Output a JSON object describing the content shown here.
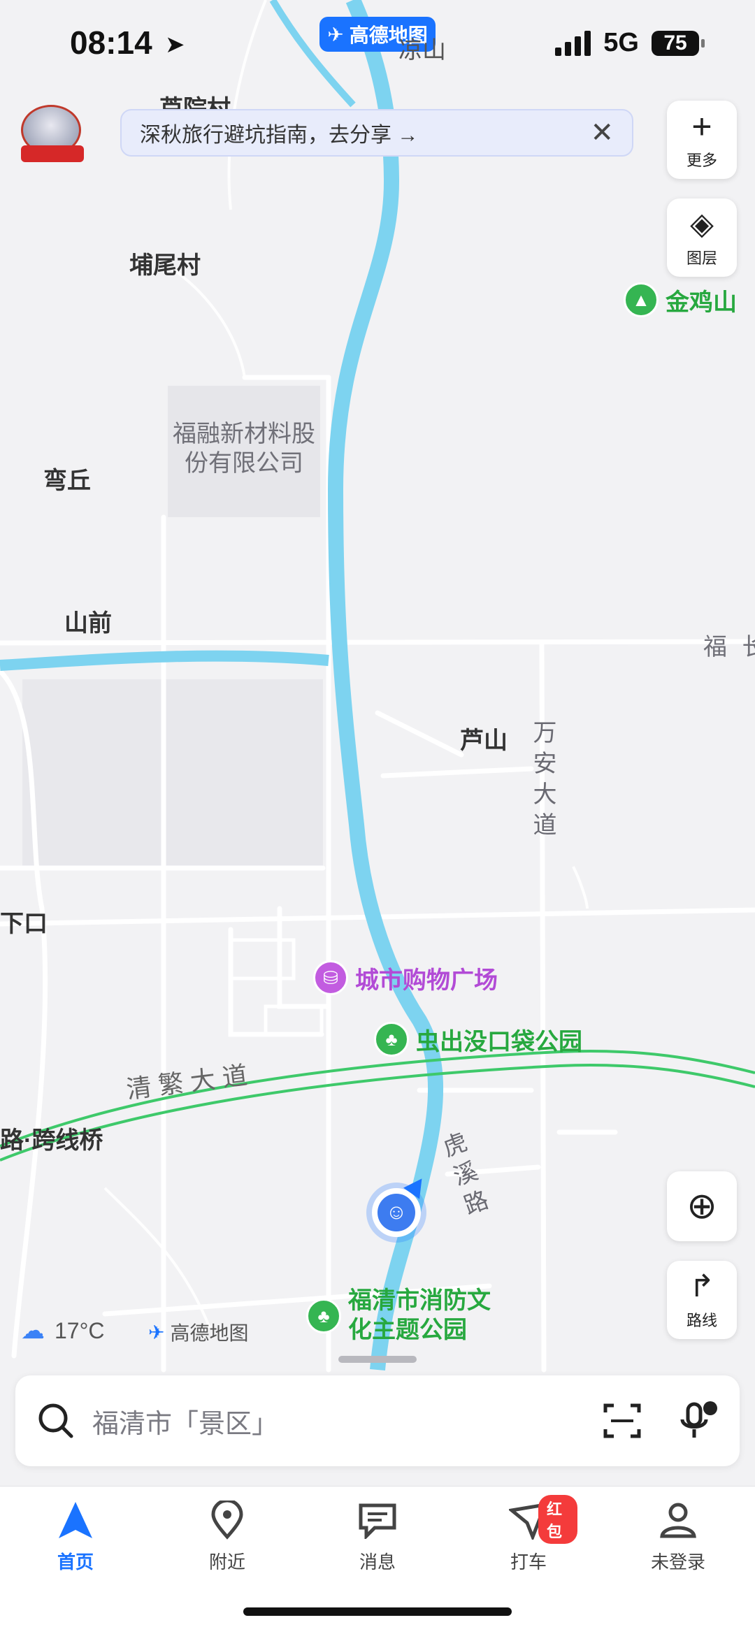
{
  "status": {
    "time": "08:14",
    "network": "5G",
    "battery": "75"
  },
  "app_pill": "高德地图",
  "banner": {
    "text": "深秋旅行避坑指南，去分享 →"
  },
  "side_buttons": {
    "more": "更多",
    "layers": "图层",
    "route": "路线"
  },
  "map": {
    "labels": {
      "top_partial": "芦院村",
      "top_mountain": "凉山",
      "village1": "埔尾村",
      "company": "福融新材料股份有限公司",
      "wanqiu": "弯丘",
      "shanqian": "山前",
      "lushan": "芦山",
      "road_wanan": "万安大道",
      "xiakou": "下口",
      "road_qingfan": "清 繁 大 道",
      "bridge": "路·跨线桥",
      "road_huxi": "虎溪路",
      "right_partial": "福 长"
    },
    "pois": {
      "jinjishan": "金鸡山",
      "mall": "城市购物广场",
      "park1": "虫出没口袋公园",
      "park2": "福清市消防文化主题公园"
    },
    "weather": "17°C",
    "watermark": "高德地图"
  },
  "search": {
    "placeholder": "福清市「景区」"
  },
  "tabs": [
    {
      "label": "首页"
    },
    {
      "label": "附近"
    },
    {
      "label": "消息"
    },
    {
      "label": "打车",
      "badge": "红包"
    },
    {
      "label": "未登录"
    }
  ],
  "colors": {
    "accent": "#1a73ff",
    "river": "#7dd3f0",
    "green_road": "#3ec96a",
    "poi_green": "#27a83f",
    "poi_purple": "#b24bd6"
  }
}
